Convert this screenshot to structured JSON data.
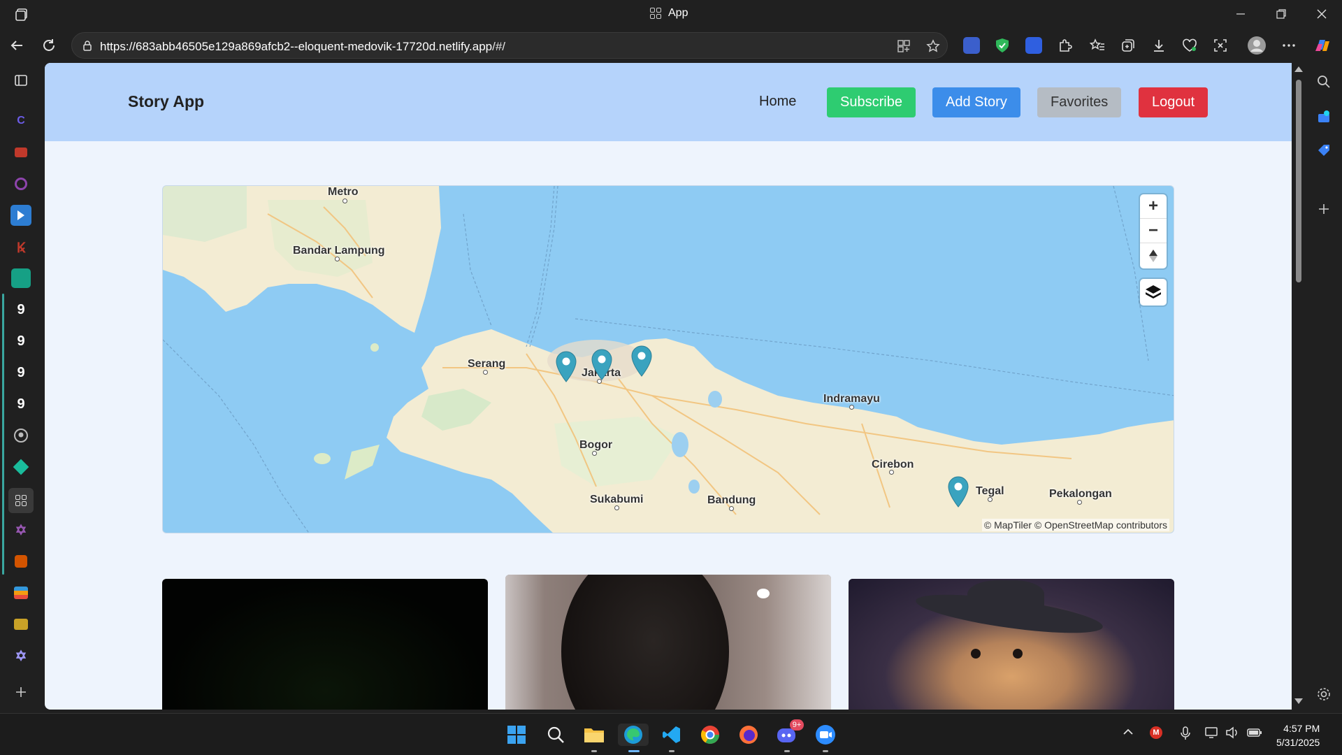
{
  "window": {
    "title": "App"
  },
  "browser": {
    "url_host": "https://683abb46505e129a869afcb2--eloquent-medovik-17720d.netlify.app",
    "url_path": "/#/"
  },
  "app": {
    "brand": "Story App",
    "nav": {
      "home": "Home",
      "subscribe": "Subscribe",
      "add_story": "Add Story",
      "favorites": "Favorites",
      "logout": "Logout"
    },
    "colors": {
      "header_bg": "#b5d3fb",
      "subscribe": "#2ecc71",
      "add_story": "#3c8dea",
      "favorites": "#b5bcc4",
      "logout": "#e0323f",
      "marker": "#3aa3bf"
    }
  },
  "map": {
    "cities": [
      "Metro",
      "Bandar Lampung",
      "Serang",
      "Jakarta",
      "Bogor",
      "Sukabumi",
      "Bandung",
      "Indramayu",
      "Cirebon",
      "Tegal",
      "Pekalongan"
    ],
    "marker_count": 4,
    "zoom_in": "+",
    "zoom_out": "−",
    "attribution": "© MapTiler © OpenStreetMap contributors"
  },
  "stories": [
    {
      "image": "dark-night-photo"
    },
    {
      "image": "lens-closeup-photo"
    },
    {
      "image": "cat-with-witch-hat-photo"
    }
  ],
  "taskbar": {
    "time": "4:57 PM",
    "date": "5/31/2025",
    "discord_badge": "9+"
  }
}
